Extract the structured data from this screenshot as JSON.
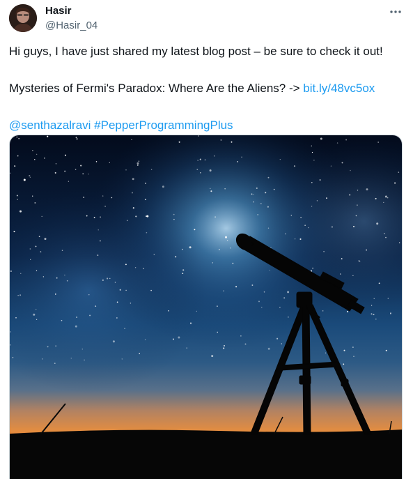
{
  "tweet": {
    "author": {
      "display_name": "Hasir",
      "handle": "@Hasir_04",
      "avatar_icon": "avatar-photo"
    },
    "more_icon": "more-horizontal-icon",
    "text": {
      "line1": "Hi guys, I have just shared my latest blog post – be sure to check it out!",
      "line2_prefix": "Mysteries of Fermi's Paradox: Where Are the Aliens? -> ",
      "link": "bit.ly/48vc5ox",
      "mention": "@senthazalravi",
      "hashtag": "#PepperProgrammingPlus"
    },
    "media": {
      "type": "image",
      "subject": "telescope-silhouette-starry-sky"
    },
    "colors": {
      "link": "#1d9bf0",
      "text": "#0f1419",
      "secondary": "#536471"
    }
  }
}
